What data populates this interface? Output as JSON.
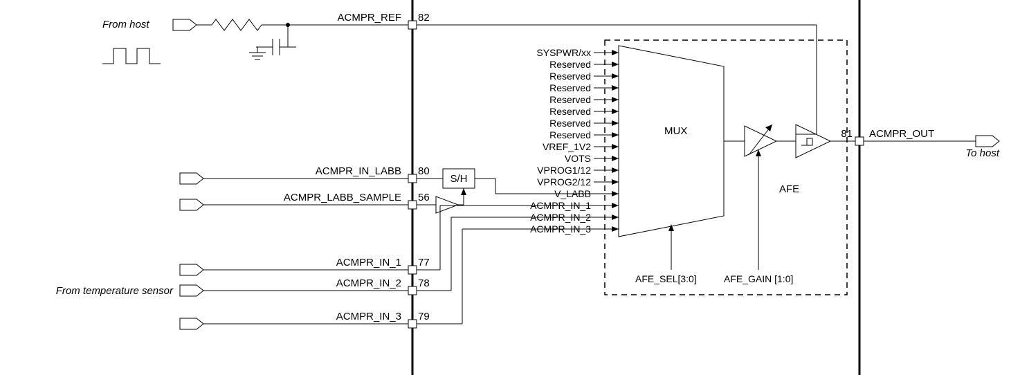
{
  "pins": {
    "ref": {
      "label": "ACMPR_REF",
      "num": "82"
    },
    "labb": {
      "label": "ACMPR_IN_LABB",
      "num": "80"
    },
    "sample": {
      "label": "ACMPR_LABB_SAMPLE",
      "num": "56"
    },
    "in1": {
      "label": "ACMPR_IN_1",
      "num": "77"
    },
    "in2": {
      "label": "ACMPR_IN_2",
      "num": "78"
    },
    "in3": {
      "label": "ACMPR_IN_3",
      "num": "79"
    },
    "out": {
      "label": "ACMPR_OUT",
      "num": "81"
    }
  },
  "annotations": {
    "from_host": "From host",
    "to_host": "To host",
    "from_temp": "From temperature sensor",
    "sh": "S/H",
    "mux": "MUX",
    "afe": "AFE",
    "afe_sel": "AFE_SEL[3:0]",
    "afe_gain": "AFE_GAIN [1:0]"
  },
  "mux_inputs": [
    "SYSPWR/xx",
    "Reserved",
    "Reserved",
    "Reserved",
    "Reserved",
    "Reserved",
    "Reserved",
    "Reserved",
    "VREF_1V2",
    "VOTS",
    "VPROG1/12",
    "VPROG2/12",
    "V_LABB",
    "ACMPR_IN_1",
    "ACMPR_IN_2",
    "ACMPR_IN_3"
  ]
}
